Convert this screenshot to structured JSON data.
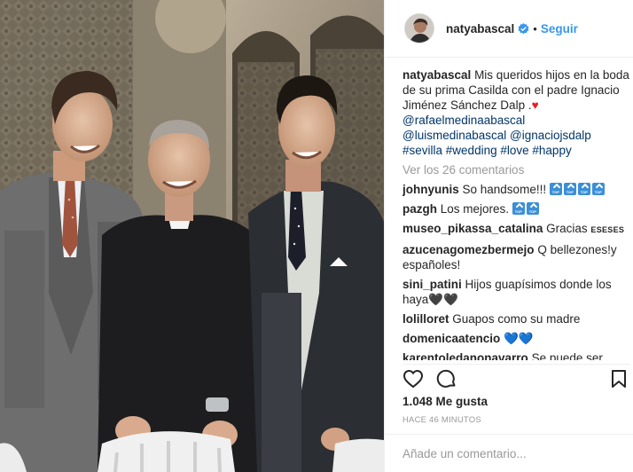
{
  "post": {
    "username": "natyabascal",
    "follow_label": "Seguir",
    "dot": "•",
    "caption": {
      "username": "natyabascal",
      "text": "Mis queridos hijos en la boda de su prima Casilda con el padre Ignacio Jiménez Sánchez Dalp .",
      "heart": "♥",
      "mentions": [
        "@rafaelmedinaabascal",
        "@luismedinabascal",
        "@ignaciojsdalp"
      ],
      "hashtags": [
        "#sevilla",
        "#wedding",
        "#love",
        "#happy"
      ]
    },
    "view_comments": "Ver los 26 comentarios",
    "comments": [
      {
        "user": "johnyunis",
        "text": "So handsome!!!",
        "badges": 4
      },
      {
        "user": "pazgh",
        "text": "Los mejores.",
        "badges": 2
      },
      {
        "user": "museo_pikassa_catalina",
        "text": "Gracias",
        "suffix": "ESESES"
      },
      {
        "user": "azucenagomezbermejo",
        "text": "Q bellezones!y españoles!"
      },
      {
        "user": "sini_patini",
        "text": "Hijos guapísimos donde los haya",
        "emoji": "🖤🖤"
      },
      {
        "user": "lolilloret",
        "text": "Guapos como su madre"
      },
      {
        "user": "domenicaatencio",
        "text": "",
        "emoji": "💙💙"
      },
      {
        "user": "karentoledanonavarro",
        "text": "Se puede ser"
      }
    ],
    "likes": "1.048 Me gusta",
    "time": "HACE 46 MINUTOS",
    "add_comment_placeholder": "Añade un comentario..."
  },
  "icons": {
    "verified": "verified-badge-icon",
    "like": "heart-outline-icon",
    "comment": "speech-bubble-icon",
    "save": "bookmark-icon"
  },
  "colors": {
    "link": "#003569",
    "follow": "#3897f0",
    "muted": "#999999",
    "heart": "#ed1c24"
  }
}
